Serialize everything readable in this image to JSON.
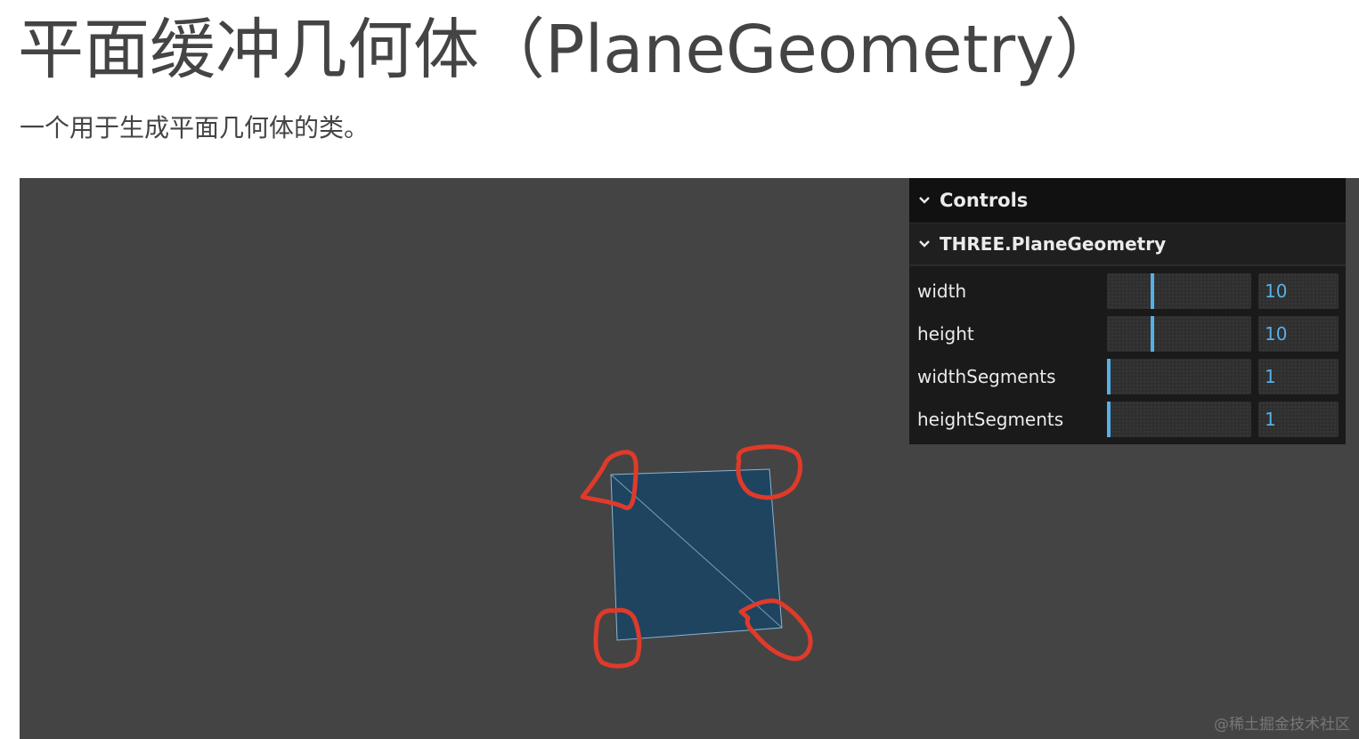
{
  "page": {
    "title": "平面缓冲几何体（PlaneGeometry）",
    "description": "一个用于生成平面几何体的类。"
  },
  "gui": {
    "title": "Controls",
    "folder_title": "THREE.PlaneGeometry",
    "rows": [
      {
        "label": "width",
        "value": "10",
        "slider_fraction": 0.31
      },
      {
        "label": "height",
        "value": "10",
        "slider_fraction": 0.31
      },
      {
        "label": "widthSegments",
        "value": "1",
        "slider_fraction": 0.0
      },
      {
        "label": "heightSegments",
        "value": "1",
        "slider_fraction": 0.0
      }
    ],
    "accent_color": "#56b0e8"
  },
  "scene": {
    "background_color": "#444444",
    "plane_color": "#1f4460",
    "edge_color": "#8ab4d0",
    "annotation_color": "#e03a2a"
  },
  "watermark": "@稀土掘金技术社区",
  "icons": {
    "gui_collapse": "chevron-down-icon",
    "folder_collapse": "chevron-down-icon"
  }
}
